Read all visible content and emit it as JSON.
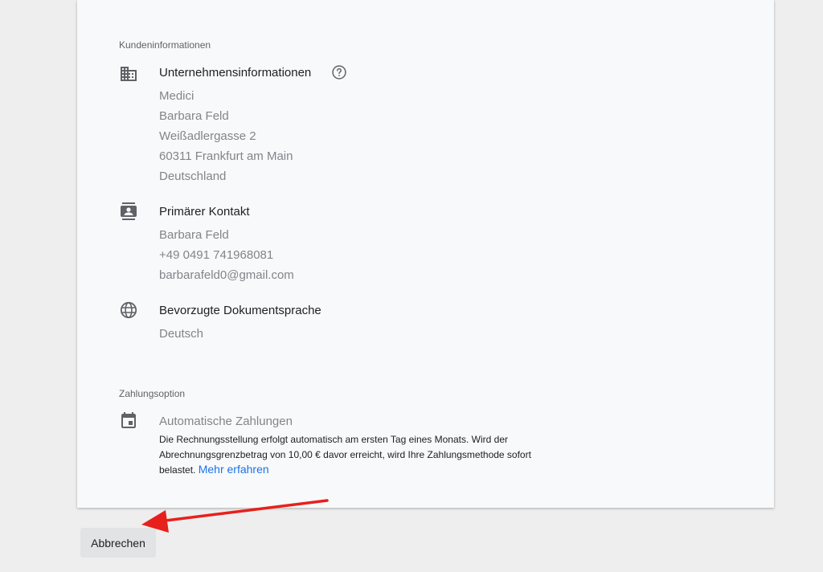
{
  "customer": {
    "section_label": "Kundeninformationen",
    "company": {
      "title": "Unternehmensinformationen",
      "icon": "business-icon",
      "lines": [
        "Medici",
        "Barbara Feld",
        "Weißadlergasse 2",
        "60311 Frankfurt am Main",
        "Deutschland"
      ]
    },
    "contact": {
      "title": "Primärer Kontakt",
      "icon": "contact-icon",
      "lines": [
        "Barbara Feld",
        "+49  0491 741968081",
        "barbarafeld0@gmail.com"
      ]
    },
    "language": {
      "title": "Bevorzugte Dokumentsprache",
      "icon": "globe-icon",
      "value": "Deutsch"
    }
  },
  "payment": {
    "section_label": "Zahlungsoption",
    "title": "Automatische Zahlungen",
    "icon": "calendar-icon",
    "description": "Die Rechnungsstellung erfolgt automatisch am ersten Tag eines Monats. Wird der Abrechnungsgrenzbetrag von 10,00 € davor erreicht, wird Ihre Zahlungsmethode sofort belastet.",
    "link_label": "Mehr erfahren"
  },
  "footer": {
    "cancel_label": "Abbrechen"
  },
  "colors": {
    "accent_link": "#1a73e8",
    "annotation_arrow": "#e8201c"
  }
}
